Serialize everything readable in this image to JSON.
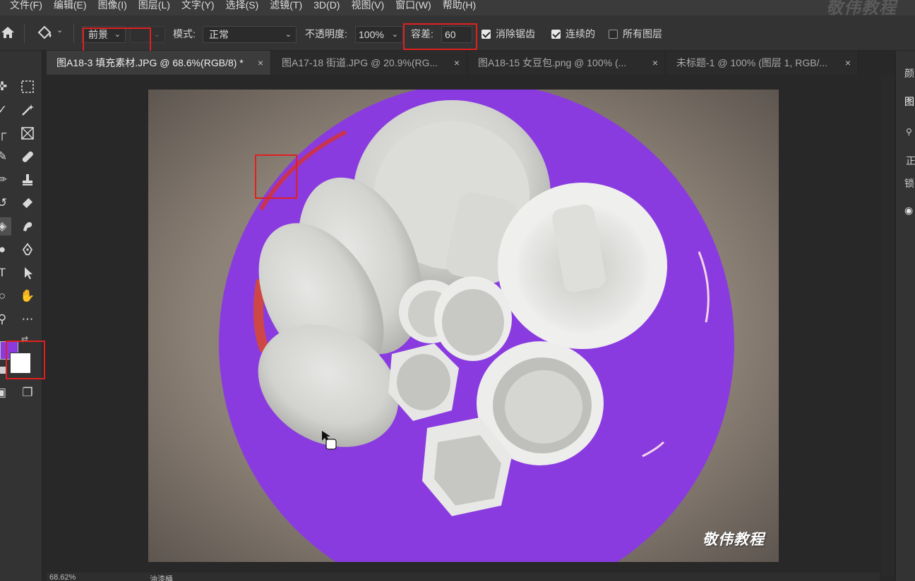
{
  "menu": {
    "items": [
      "文件(F)",
      "编辑(E)",
      "图像(I)",
      "图层(L)",
      "文字(Y)",
      "选择(S)",
      "滤镜(T)",
      "3D(D)",
      "视图(V)",
      "窗口(W)",
      "帮助(H)"
    ],
    "watermark": "敬伟教程"
  },
  "options": {
    "fill_source": "前景",
    "mode_label": "模式:",
    "mode_value": "正常",
    "opacity_label": "不透明度:",
    "opacity_value": "100%",
    "tolerance_label": "容差:",
    "tolerance_value": "60",
    "antialias_label": "消除锯齿",
    "antialias_checked": true,
    "contiguous_label": "连续的",
    "contiguous_checked": true,
    "all_layers_label": "所有图层",
    "all_layers_checked": false
  },
  "tabs": [
    {
      "label": "图A18-3 填充素材.JPG @ 68.6%(RGB/8) *",
      "active": true
    },
    {
      "label": "图A17-18 街道.JPG @ 20.9%(RG...",
      "active": false
    },
    {
      "label": "图A18-15 女豆包.png @ 100% (...",
      "active": false
    },
    {
      "label": "未标题-1 @ 100% (图层 1, RGB/...",
      "active": false
    }
  ],
  "tabs_close_glyph": "×",
  "colors": {
    "foreground": "#8a3be0",
    "background": "#ffffff",
    "fill_purple": "#8a3be0",
    "highlight_box": "#e02020"
  },
  "canvas": {
    "watermark": "敬伟教程"
  },
  "right_panel": {
    "labels": [
      "颜",
      "图",
      "正",
      "锁"
    ]
  },
  "status": {
    "zoom": "68.62%",
    "text": "油漆桶"
  }
}
